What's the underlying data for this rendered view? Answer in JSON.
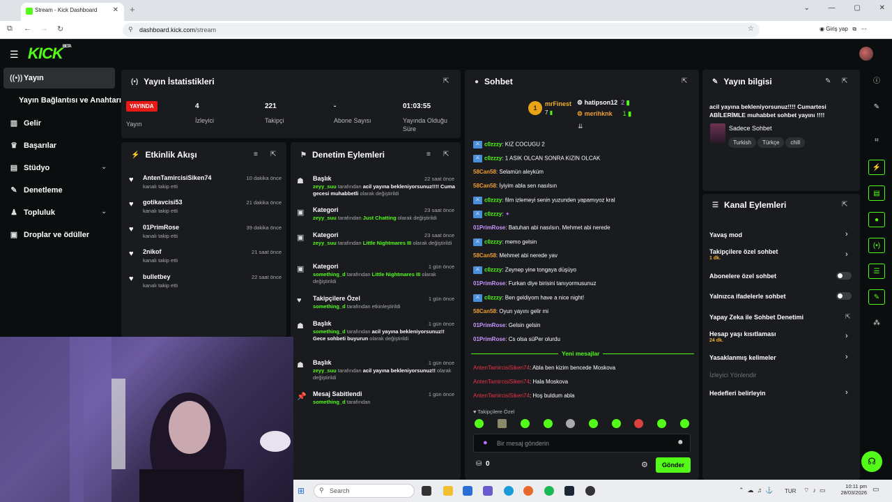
{
  "browser": {
    "tab_title": "Stream - Kick Dashboard",
    "url_domain": "dashboard.kick.com",
    "url_path": "/stream",
    "login_label": "Giriş yap"
  },
  "logo": {
    "text": "KICK",
    "badge": "BETA"
  },
  "sidebar": {
    "items": [
      {
        "label": "Yayın",
        "icon": "broadcast-icon"
      },
      {
        "label": "Yayın Bağlantısı ve Anahtarı",
        "icon": "none"
      },
      {
        "label": "Gelir",
        "icon": "chart-icon"
      },
      {
        "label": "Başarılar",
        "icon": "trophy-icon"
      },
      {
        "label": "Stüdyo",
        "icon": "studio-icon"
      },
      {
        "label": "Denetleme",
        "icon": "wrench-icon"
      },
      {
        "label": "Topluluk",
        "icon": "community-icon"
      },
      {
        "label": "Droplar ve ödüller",
        "icon": "gift-icon"
      }
    ]
  },
  "stats": {
    "title": "Yayın İstatistikleri",
    "live_badge": "YAYINDA",
    "live_label": "Yayın",
    "viewers": {
      "value": "4",
      "label": "İzleyici"
    },
    "followers": {
      "value": "221",
      "label": "Takipçi"
    },
    "subs": {
      "value": "-",
      "label": "Abone Sayısı"
    },
    "duration": {
      "value": "01:03:55",
      "label": "Yayında Olduğu Süre"
    }
  },
  "activity": {
    "title": "Etkinlik Akışı",
    "items": [
      {
        "name": "AntenTamircisiSiken74",
        "sub": "kanalı takip etti",
        "time": "10 dakika önce"
      },
      {
        "name": "gotikavcisi53",
        "sub": "kanalı takip etti",
        "time": "21 dakika önce"
      },
      {
        "name": "01PrimRose",
        "sub": "kanalı takip etti",
        "time": "39 dakika önce"
      },
      {
        "name": "2nikof",
        "sub": "kanalı takip etti",
        "time": "21 saat önce"
      },
      {
        "name": "bulletbey",
        "sub": "kanalı takip etti",
        "time": "22 saat önce"
      }
    ]
  },
  "moderation": {
    "title": "Denetim Eylemleri",
    "items": [
      {
        "title": "Başlık",
        "time": "22 saat önce",
        "user": "zeyy_suu",
        "mid": "tarafından",
        "value": "acil yayına bekleniyorsunuz!!!! Cuma gecesi muhabbetli",
        "tail": "olarak değiştirildi"
      },
      {
        "title": "Kategori",
        "time": "23 saat önce",
        "user": "zeyy_suu",
        "mid": "tarafından",
        "value": "Just Chatting",
        "tail": "olarak değiştirildi"
      },
      {
        "title": "Kategori",
        "time": "23 saat önce",
        "user": "zeyy_suu",
        "mid": "tarafından",
        "value": "Little Nightmares III",
        "tail": "olarak değiştirildi"
      },
      {
        "title": "Kategori",
        "time": "1 gün önce",
        "user": "something_d",
        "mid": "tarafından",
        "value": "Little Nightmares III",
        "tail": "olarak değiştirildi"
      },
      {
        "title": "Takipçilere Özel",
        "time": "1 gün önce",
        "user": "something_d",
        "mid": "tarafından etkinleştirildi",
        "value": "",
        "tail": ""
      },
      {
        "title": "Başlık",
        "time": "1 gün önce",
        "user": "something_d",
        "mid": "tarafından",
        "value": "acil yayına bekleniyorsunuz!! Gece sohbeti buyurun",
        "tail": "olarak değiştirildi"
      },
      {
        "title": "Başlık",
        "time": "1 gün önce",
        "user": "zeyy_suu",
        "mid": "tarafından",
        "value": "acil yayına bekleniyorsunuz!!",
        "tail": "olarak değiştirildi"
      },
      {
        "title": "Mesaj Sabitlendi",
        "time": "1 gün önce",
        "user": "something_d",
        "mid": "tarafından",
        "value": "",
        "tail": ""
      }
    ]
  },
  "chat": {
    "title": "Sohbet",
    "leaders": [
      {
        "name": "mrFinest",
        "count": "7",
        "rank": "1"
      },
      {
        "name": "hatipson12",
        "count": "2"
      },
      {
        "name": "merihknk",
        "count": "1"
      }
    ],
    "messages": [
      {
        "user": "c0zzzy",
        "text": ": KIZ COCUGU 2",
        "color": "g",
        "badge": true
      },
      {
        "user": "c0zzzy",
        "text": ": 1 ASIK OLCAN SONRA KIZIN OLCAK",
        "color": "g",
        "badge": true
      },
      {
        "user": "58Can58",
        "text": ": Selamün aleyküm",
        "color": "o",
        "badge": false
      },
      {
        "user": "58Can58",
        "text": ": İyiyim abla sen nasılsın",
        "color": "o",
        "badge": false
      },
      {
        "user": "c0zzzy",
        "text": ": film izlemeyi senin yuzunden yapamıyoz kral",
        "color": "g",
        "badge": true
      },
      {
        "user": "c0zzzy",
        "text": ":",
        "color": "g",
        "badge": true
      },
      {
        "user": "01PrimRose",
        "text": ": Batuhan abi nasılsın. Mehmet abi nerede",
        "color": "p",
        "badge": false
      },
      {
        "user": "c0zzzy",
        "text": ": memo gelsin",
        "color": "g",
        "badge": true
      },
      {
        "user": "58Can58",
        "text": ": Mehmet abi nerede yav",
        "color": "o",
        "badge": false
      },
      {
        "user": "c0zzzy",
        "text": ": Zeynep yine tongaya düşüyo",
        "color": "g",
        "badge": true
      },
      {
        "user": "01PrimRose",
        "text": ": Furkan diye birisini tanıyormusunuz",
        "color": "p",
        "badge": false
      },
      {
        "user": "c0zzzy",
        "text": ": Ben geldiyom have a nice night!",
        "color": "g",
        "badge": true
      },
      {
        "user": "58Can58",
        "text": ": Oyun yayını gelir mi",
        "color": "o",
        "badge": false
      },
      {
        "user": "01PrimRose",
        "text": ": Gelsin gelsin",
        "color": "p",
        "badge": false
      },
      {
        "user": "01PrimRose",
        "text": ": Cs olsa süPer olurdu",
        "color": "p",
        "badge": false
      }
    ],
    "new_messages_label": "Yeni mesajlar",
    "new_messages": [
      {
        "user": "AntenTamircisiSiken74",
        "text": ": Abla ben kizim bencede Moskova"
      },
      {
        "user": "AntenTamircisiSiken74",
        "text": ": Hala Moskova"
      },
      {
        "user": "AntenTamircisiSiken74",
        "text": ": Hoş buldum abla"
      }
    ],
    "followers_only": "Takipçilere Özel",
    "placeholder": "Bir mesaj gönderin",
    "points": "0",
    "send_label": "Gönder"
  },
  "stream_info": {
    "title": "Yayın bilgisi",
    "stream_title": "acil yayına bekleniyorsunuz!!!! Cumartesi ABİLERİMLE muhabbet sohbet yayını !!!!",
    "category": "Sadece Sohbet",
    "tags": [
      "Turkish",
      "Türkçe",
      "chill"
    ]
  },
  "channel_actions": {
    "title": "Kanal Eylemleri",
    "slow_mode": "Yavaş mod",
    "followers_chat": "Takipçilere özel sohbet",
    "followers_chat_sub": "1 dk.",
    "subs_chat": "Abonelere özel sohbet",
    "emote_chat": "Yalnızca ifadelerle sohbet",
    "ai_mod": "Yapay Zeka ile Sohbet Denetimi",
    "age_limit": "Hesap yaşı kısıtlaması",
    "age_limit_sub": "24 dk.",
    "banned_words": "Yasaklanmış kelimeler",
    "viewer_redirect": "İzleyici Yönlendir",
    "goals": "Hedefleri belirleyin"
  },
  "taskbar": {
    "search": "Search",
    "lang": "TUR",
    "time": "10:11 pm",
    "date": "28/03/2026"
  },
  "colors": {
    "brand": "#53fc18",
    "live": "#e91916",
    "panel": "#191b1f"
  }
}
